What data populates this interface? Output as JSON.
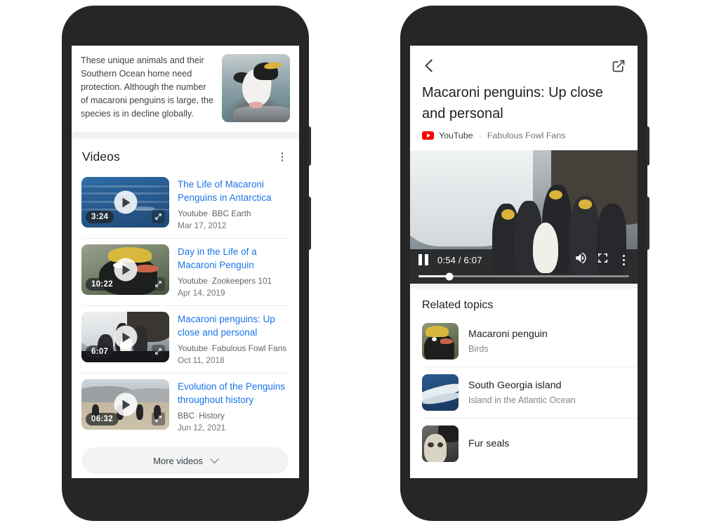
{
  "left_phone": {
    "description": {
      "text": "These unique animals and their Southern Ocean home need protection. Although the number of macaroni penguins is large, the species is in decline globally.",
      "thumb_alt": "macaroni-penguin-photo"
    },
    "videos_section": {
      "heading": "Videos",
      "menu_icon": "kebab-menu-icon",
      "items": [
        {
          "title": "The Life of Macaroni Penguins in Antarctica",
          "source": "Youtube",
          "channel": "BBC Earth",
          "date": "Mar 17, 2012",
          "duration": "3:24",
          "art": "art-ocean"
        },
        {
          "title": "Day in the Life of a Macaroni Penguin",
          "source": "Youtube",
          "channel": "Zookeepers 101",
          "date": "Apr 14, 2019",
          "duration": "10:22",
          "art": "art-penguin-head"
        },
        {
          "title": "Macaroni penguins:  Up close and personal",
          "source": "Youtube",
          "channel": "Fabulous Fowl Fans",
          "date": "Oct 11, 2018",
          "duration": "6:07",
          "art": "art-colony"
        },
        {
          "title": "Evolution of the Penguins throughout history",
          "source": "BBC",
          "channel": "History",
          "date": "Jun 12, 2021",
          "duration": "06:32",
          "art": "art-beach"
        }
      ],
      "more_button": {
        "label": "More videos",
        "icon": "chevron-down-icon"
      }
    }
  },
  "right_phone": {
    "topbar": {
      "back_icon": "back-chevron-icon",
      "external_icon": "open-in-new-icon"
    },
    "video": {
      "title": "Macaroni penguins:  Up close and personal",
      "source": "YouTube",
      "separator": "·",
      "channel": "Fabulous Fowl Fans",
      "player": {
        "state_icon": "pause-icon",
        "current_time": "0:54",
        "time_separator": "/",
        "duration": "6:07",
        "timecode": "0:54 / 6:07",
        "volume_icon": "volume-up-icon",
        "fullscreen_icon": "fullscreen-icon",
        "menu_icon": "kebab-menu-icon",
        "progress_percent": 14.7
      }
    },
    "related": {
      "heading": "Related topics",
      "items": [
        {
          "name": "Macaroni penguin",
          "subtitle": "Birds",
          "art": "art-macpeng"
        },
        {
          "name": "South Georgia island",
          "subtitle": "Island in the Atlantic Ocean",
          "art": "art-island"
        },
        {
          "name": "Fur seals",
          "subtitle": "",
          "art": "art-seal"
        }
      ]
    }
  },
  "colors": {
    "link_blue": "#1a73e8",
    "youtube_red": "#ff0000",
    "text_primary": "#202124",
    "text_secondary": "#5f6368",
    "chip_bg": "#f1f3f4",
    "frame": "#262626"
  }
}
